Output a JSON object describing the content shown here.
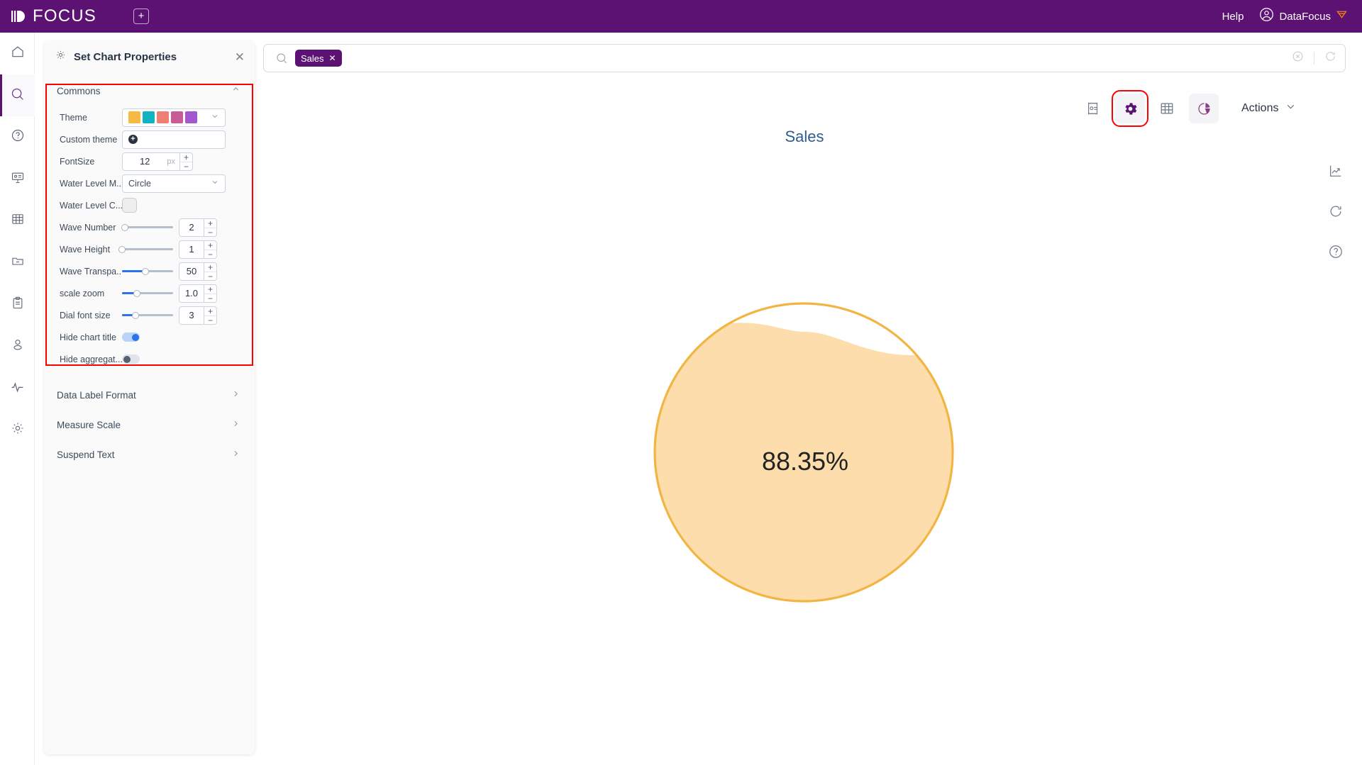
{
  "topbar": {
    "brand": "FOCUS",
    "new_tab_icon": "plus-square-icon",
    "help_label": "Help",
    "account_name": "DataFocus",
    "brand_color": "#5c1273"
  },
  "rail": {
    "items": [
      {
        "icon": "home-icon",
        "name": "home",
        "active": false
      },
      {
        "icon": "search-icon",
        "name": "search",
        "active": true
      },
      {
        "icon": "question-circle-icon",
        "name": "help",
        "active": false
      },
      {
        "icon": "presentation-icon",
        "name": "dashboard",
        "active": false
      },
      {
        "icon": "table-grid-icon",
        "name": "data-table",
        "active": false
      },
      {
        "icon": "folder-minus-icon",
        "name": "folder",
        "active": false
      },
      {
        "icon": "clipboard-icon",
        "name": "clipboard",
        "active": false
      },
      {
        "icon": "user-icon",
        "name": "user",
        "active": false
      },
      {
        "icon": "pulse-icon",
        "name": "monitor",
        "active": false
      },
      {
        "icon": "gear-icon",
        "name": "settings",
        "active": false
      }
    ]
  },
  "panel": {
    "title": "Set Chart Properties",
    "gear_icon": "gear-icon",
    "close_icon": "close-icon",
    "commons": {
      "label": "Commons",
      "caret": "chevron-up-icon",
      "properties": [
        {
          "label": "Theme",
          "type": "swatches",
          "swatches": [
            "#f5b944",
            "#12b3c0",
            "#ef7f73",
            "#c75c96",
            "#a458cf"
          ],
          "caret": "chevron-down-icon"
        },
        {
          "label": "Custom theme",
          "type": "add",
          "icon": "plus-circle-icon"
        },
        {
          "label": "FontSize",
          "type": "stepper",
          "value": "12",
          "unit": "px"
        },
        {
          "label": "Water Level M...",
          "type": "select",
          "value": "Circle",
          "caret": "chevron-down-icon"
        },
        {
          "label": "Water Level C...",
          "type": "color",
          "value": "#eeeeee"
        },
        {
          "label": "Wave Number",
          "type": "slider",
          "value": "2",
          "fill_percent": 4
        },
        {
          "label": "Wave Height",
          "type": "slider",
          "value": "1",
          "fill_percent": 0
        },
        {
          "label": "Wave Transpa...",
          "type": "slider",
          "value": "50",
          "fill_percent": 45
        },
        {
          "label": "scale zoom",
          "type": "slider",
          "value": "1.0",
          "fill_percent": 30
        },
        {
          "label": "Dial font size",
          "type": "slider",
          "value": "3",
          "fill_percent": 28
        },
        {
          "label": "Hide chart title",
          "type": "toggle",
          "state": "on"
        },
        {
          "label": "Hide aggregat...",
          "type": "toggle",
          "state": "off"
        }
      ]
    },
    "sections": [
      {
        "label": "Data Label Format",
        "caret": "chevron-right-icon"
      },
      {
        "label": "Measure Scale",
        "caret": "chevron-right-icon"
      },
      {
        "label": "Suspend Text",
        "caret": "chevron-right-icon"
      }
    ]
  },
  "search": {
    "icon": "search-icon",
    "chips": [
      {
        "label": "Sales",
        "remove_icon": "close-icon"
      }
    ],
    "clear_icon": "clear-circle-icon",
    "refresh_icon": "refresh-icon"
  },
  "toolbar": {
    "buttons": [
      {
        "name": "answer-icon",
        "label": "",
        "selected": false,
        "soft": false
      },
      {
        "name": "gear-icon",
        "label": "",
        "selected": true,
        "soft": true
      },
      {
        "name": "table-grid-icon",
        "label": "",
        "selected": false,
        "soft": false
      },
      {
        "name": "pie-chart-icon",
        "label": "",
        "selected": false,
        "soft": true
      }
    ],
    "actions_label": "Actions",
    "actions_caret": "chevron-down-icon"
  },
  "side_tools": [
    {
      "name": "trend-chart-icon"
    },
    {
      "name": "refresh-icon"
    },
    {
      "name": "question-circle-icon"
    }
  ],
  "chart_data": {
    "type": "gauge",
    "title": "Sales",
    "value": 88.35,
    "value_label": "88.35%",
    "unit": "%",
    "shape": "Circle",
    "wave_number": 2,
    "wave_height": 1,
    "wave_transparency": 50,
    "fill_color": "#fcddab",
    "border_color": "#f2b544",
    "background_color": "#ffffff",
    "ylim": [
      0,
      100
    ],
    "xlabel": "",
    "ylabel": "",
    "grid": false,
    "legend": "none"
  }
}
